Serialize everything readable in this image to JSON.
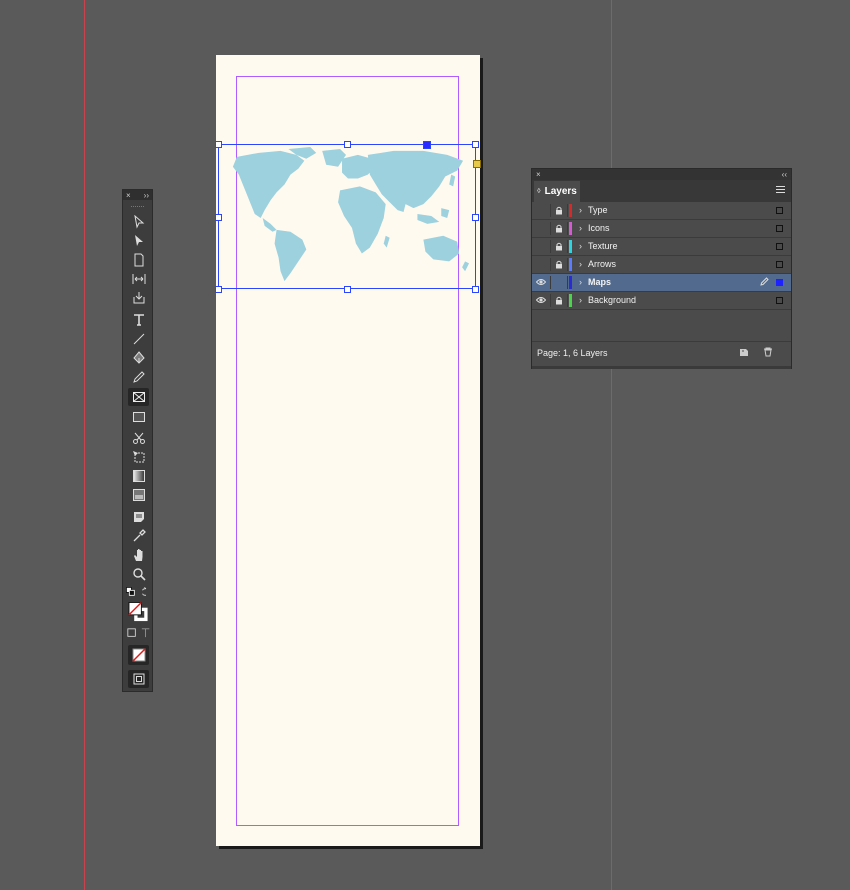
{
  "layers_panel": {
    "tab_label": "Layers",
    "status": "Page: 1, 6 Layers",
    "close_glyph": "×",
    "collapse_glyph": "‹‹",
    "layers": [
      {
        "name": "Type",
        "color": "#d32b2b",
        "visible": false,
        "locked": true,
        "selected": false
      },
      {
        "name": "Icons",
        "color": "#d35cd3",
        "visible": false,
        "locked": true,
        "selected": false
      },
      {
        "name": "Texture",
        "color": "#2bd6e0",
        "visible": false,
        "locked": true,
        "selected": false
      },
      {
        "name": "Arrows",
        "color": "#5b7cff",
        "visible": false,
        "locked": true,
        "selected": false
      },
      {
        "name": "Maps",
        "color": "#2b2bd3",
        "visible": true,
        "locked": false,
        "selected": true
      },
      {
        "name": "Background",
        "color": "#4cd44c",
        "visible": true,
        "locked": true,
        "selected": false
      }
    ]
  },
  "tools_panel": {
    "close_glyph": "×",
    "expand_glyph": "››",
    "tools": [
      "selection-tool",
      "direct-selection-tool",
      "page-tool",
      "gap-tool",
      "content-collector-tool",
      "type-tool",
      "line-tool",
      "pen-tool",
      "pencil-tool",
      "rectangle-frame-tool",
      "rectangle-tool",
      "scissors-tool",
      "free-transform-tool",
      "gradient-swatch-tool",
      "gradient-feather-tool",
      "note-tool",
      "eyedropper-tool",
      "hand-tool",
      "zoom-tool"
    ]
  },
  "colors": {
    "canvas": "#5a5a5a",
    "page": "#fffaf0",
    "guide": "#c9424d",
    "margin": "#b25cff",
    "frame": "#2b45ff",
    "map_fill": "#9dd1de"
  }
}
